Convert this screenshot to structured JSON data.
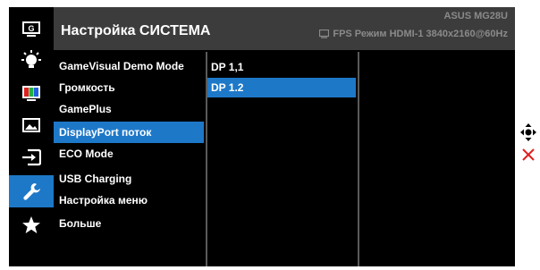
{
  "header": {
    "title": "Настройка СИСТЕМА",
    "model": "ASUS  MG28U",
    "status": "FPS Режим HDMI-1  3840x2160@60Hz"
  },
  "sidebar": {
    "items": [
      {
        "icon": "gamevisual-icon"
      },
      {
        "icon": "bluelight-icon"
      },
      {
        "icon": "color-icon"
      },
      {
        "icon": "image-icon"
      },
      {
        "icon": "input-select-icon"
      },
      {
        "icon": "system-setup-icon",
        "active": true
      },
      {
        "icon": "favorite-star-icon"
      }
    ]
  },
  "menu": {
    "items": [
      {
        "label": "GameVisual Demo Mode"
      },
      {
        "label": "Громкость"
      },
      {
        "label": "GamePlus"
      },
      {
        "label": "DisplayPort поток",
        "active": true
      },
      {
        "label": "ECO Mode"
      },
      {
        "label": "USB Charging"
      },
      {
        "label": "Настройка меню"
      },
      {
        "label": "Больше"
      }
    ]
  },
  "submenu": {
    "items": [
      {
        "label": "DP 1,1"
      },
      {
        "label": "DP 1.2",
        "active": true
      }
    ]
  },
  "colors": {
    "accent": "#1e78c8",
    "header_bg": "#3c3c3c",
    "panel_bg": "#000000",
    "close_red": "#e02020"
  }
}
